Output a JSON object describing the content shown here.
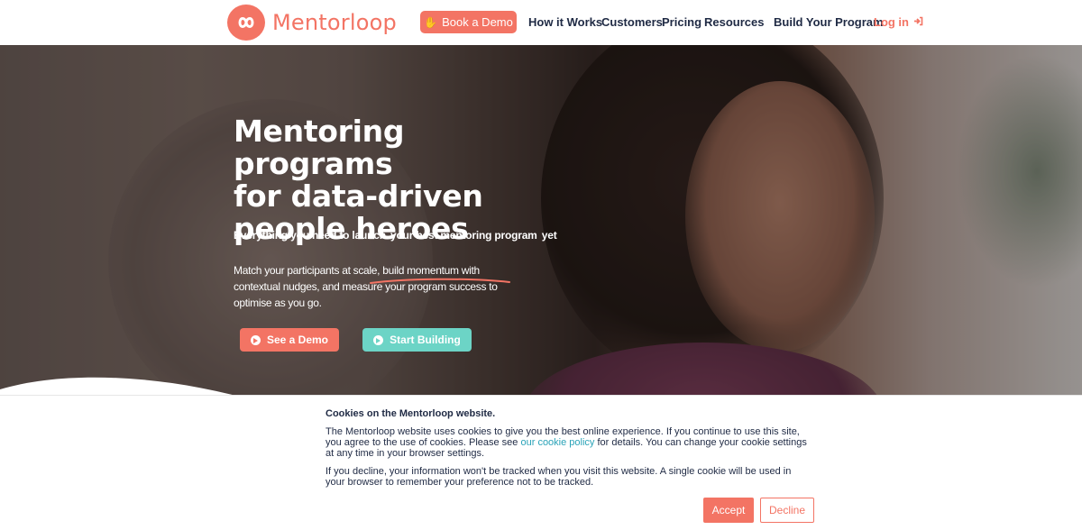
{
  "brand": {
    "name": "Mentorloop",
    "accent_color": "#f37464",
    "secondary_color": "#6cd4c6",
    "logo_icon": "infinity-loop-icon"
  },
  "nav": {
    "demo_label": "Book a Demo",
    "demo_icon": "hand-wave-icon",
    "links": [
      "How it Works",
      "Customers",
      "Pricing",
      "Resources",
      "Build Your Program"
    ],
    "login_label": "Log in",
    "login_icon": "sign-in-icon"
  },
  "hero": {
    "title_lines": [
      "Mentoring programs",
      "for data-driven",
      "people heroes"
    ],
    "subtitle_before": "Everything you need to launch ",
    "subtitle_highlight": "your best mentoring program",
    "subtitle_after": " yet",
    "body": "Match your participants at scale, build momentum with contextual nudges, and measure your program success to optimise as you go.",
    "primary_button": "See a Demo",
    "secondary_button": "Start Building"
  },
  "cookie_banner": {
    "title": "Cookies on the Mentorloop website.",
    "p1_before": "The Mentorloop website uses cookies to give you the best online experience. If you continue to use this site, you agree to the use of cookies. Please see ",
    "p1_link": "our cookie policy",
    "p1_after": " for details. You can change your cookie settings at any time in your browser settings.",
    "p2": "If you decline, your information won't be tracked when you visit this website. A single cookie will be used in your browser to remember your preference not to be tracked.",
    "accept_label": "Accept",
    "decline_label": "Decline"
  }
}
